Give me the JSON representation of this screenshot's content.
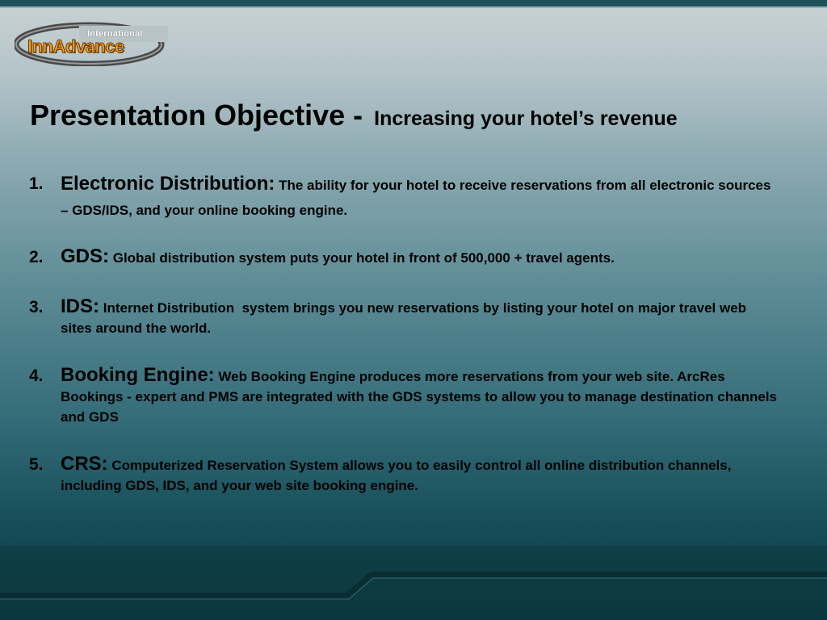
{
  "logo": {
    "small_text": "International",
    "big_text": "InnAdvance"
  },
  "title": {
    "main": "Presentation Objective -",
    "sub": "Increasing your hotel’s revenue"
  },
  "items": [
    {
      "number": "1.",
      "term": "Electronic Distribution:",
      "text": " The ability for your hotel to receive reservations from all electronic sources – GDS/IDS, and your online booking engine."
    },
    {
      "number": "2.",
      "term": "GDS:",
      "text": " Global distribution system puts your hotel in front of 500,000 + travel agents."
    },
    {
      "number": "3.",
      "term": "IDS:",
      "text": " Internet Distribution  system brings you new reservations by listing your hotel on major travel web sites around the world."
    },
    {
      "number": "4.",
      "term": "Booking Engine:",
      "text": " Web Booking Engine produces more reservations from your web site. ArcRes Bookings - expert and PMS are integrated with the GDS systems to allow you to manage destination channels and GDS"
    },
    {
      "number": "5.",
      "term": "CRS:",
      "text": " Computerized Reservation System allows you to easily control all online distribution channels, including GDS, IDS, and your web site booking engine."
    }
  ]
}
